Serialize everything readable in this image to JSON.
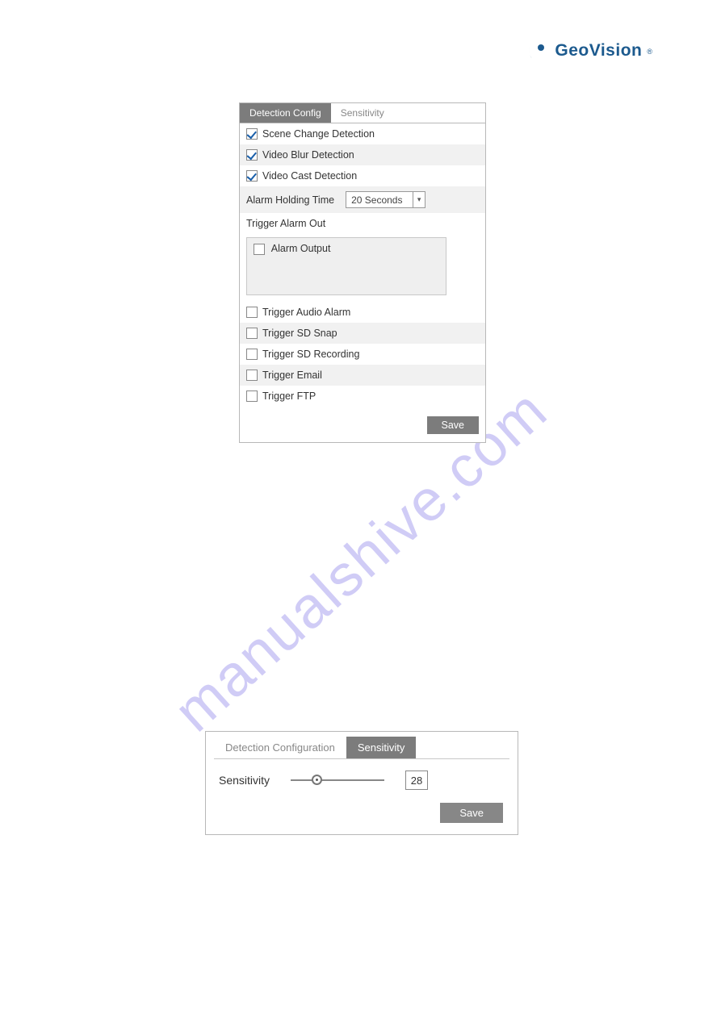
{
  "brand": {
    "name": "GeoVision"
  },
  "watermark": "manualshive.com",
  "panel1": {
    "tabs": [
      {
        "label": "Detection Config",
        "active": true
      },
      {
        "label": "Sensitivity",
        "active": false
      }
    ],
    "checks": {
      "sceneChange": "Scene Change Detection",
      "videoBlur": "Video Blur Detection",
      "videoCast": "Video Cast Detection"
    },
    "holding": {
      "label": "Alarm Holding Time",
      "value": "20 Seconds"
    },
    "triggerOut": {
      "label": "Trigger Alarm Out",
      "alarmOutput": "Alarm Output"
    },
    "triggers": {
      "audio": "Trigger Audio Alarm",
      "sdSnap": "Trigger SD Snap",
      "sdRec": "Trigger SD Recording",
      "email": "Trigger Email",
      "ftp": "Trigger FTP"
    },
    "save": "Save"
  },
  "panel2": {
    "tabs": [
      {
        "label": "Detection Configuration",
        "active": false
      },
      {
        "label": "Sensitivity",
        "active": true
      }
    ],
    "sensitivity": {
      "label": "Sensitivity",
      "value": "28"
    },
    "save": "Save"
  }
}
